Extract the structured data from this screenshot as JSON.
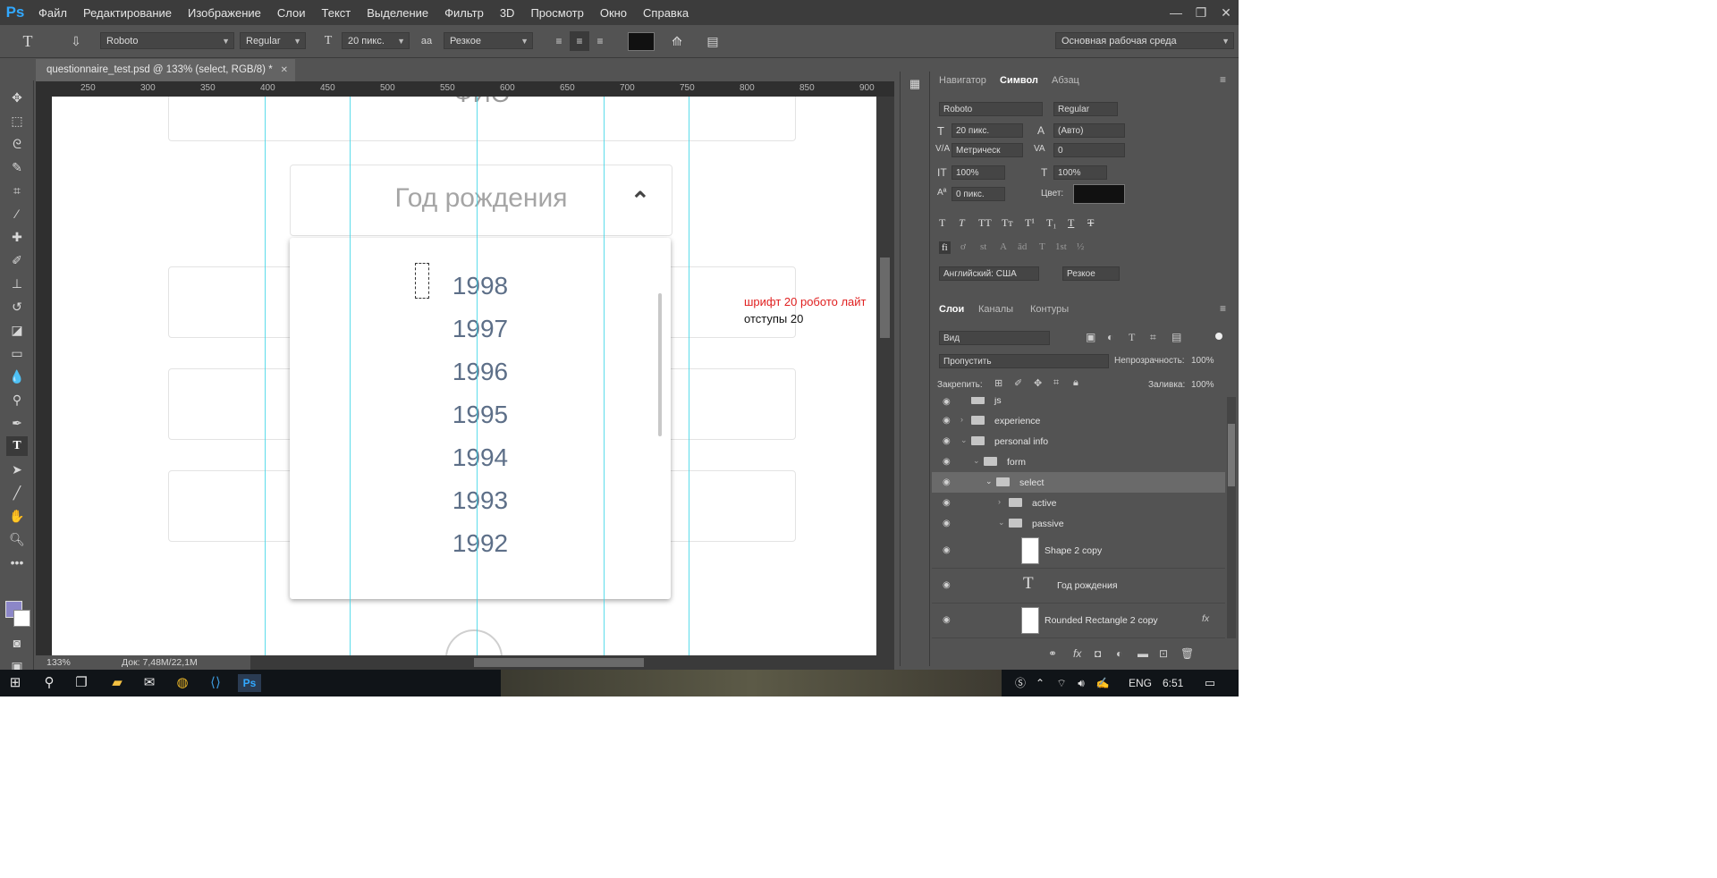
{
  "app": {
    "logo": "Ps",
    "menu": [
      "Файл",
      "Редактирование",
      "Изображение",
      "Слои",
      "Текст",
      "Выделение",
      "Фильтр",
      "3D",
      "Просмотр",
      "Окно",
      "Справка"
    ],
    "window_controls": [
      "—",
      "❐",
      "✕"
    ]
  },
  "options_bar": {
    "tool_icon": "T",
    "font_family": "Roboto",
    "font_style": "Regular",
    "font_size": "20 пикс.",
    "aa_label": "аа",
    "anti_alias": "Резкое",
    "workspace": "Основная рабочая среда"
  },
  "document": {
    "tab_title": "questionnaire_test.psd @ 133% (select, RGB/8) *",
    "tab_close": "✕",
    "zoom": "133%",
    "doc_info": "Док: 7,48M/22,1M",
    "ruler_ticks": [
      "250",
      "300",
      "350",
      "400",
      "450",
      "500",
      "550",
      "600",
      "650",
      "700",
      "750",
      "800",
      "850",
      "900"
    ],
    "fio_text": "ФИО",
    "select_placeholder": "Год рождения",
    "select_chevron": "⌃",
    "years": [
      "1998",
      "1997",
      "1996",
      "1995",
      "1994",
      "1993",
      "1992"
    ],
    "note_line1": "шрифт 20 робото лайт",
    "note_line2": "отступы 20",
    "note_color": "#e02020"
  },
  "panel_tabs_top": [
    "Навигатор",
    "Символ",
    "Абзац"
  ],
  "character": {
    "font_family": "Roboto",
    "font_style": "Regular",
    "size": "20 пикс.",
    "leading": "(Авто)",
    "kerning": "Метрическ",
    "tracking": "0",
    "vscale": "100%",
    "hscale": "100%",
    "baseline": "0 пикс.",
    "color_label": "Цвет:",
    "language": "Английский: США",
    "aa": "Резкое",
    "style_buttons": [
      "T",
      "T",
      "TT",
      "Tт",
      "T¹",
      "T₁",
      "T",
      "T"
    ],
    "ot_buttons": [
      "fi",
      "ơ",
      "st",
      "A",
      "ād",
      "T",
      "1st",
      "½"
    ]
  },
  "layers_panel": {
    "tabs": [
      "Слои",
      "Каналы",
      "Контуры"
    ],
    "filter": "Вид",
    "blend": "Пропустить",
    "opacity_label": "Непрозрачность:",
    "opacity": "100%",
    "lock_label": "Закрепить:",
    "fill_label": "Заливка:",
    "fill": "100%",
    "layers": [
      {
        "name": "js"
      },
      {
        "name": "experience"
      },
      {
        "name": "personal info"
      },
      {
        "name": "form"
      },
      {
        "name": "select"
      },
      {
        "name": "active"
      },
      {
        "name": "passive"
      },
      {
        "name": "Shape 2 copy"
      },
      {
        "name": "Год рождения"
      },
      {
        "name": "Rounded Rectangle 2 copy"
      }
    ],
    "fx": "fx"
  },
  "taskbar": {
    "lang": "ENG",
    "time": "6:51",
    "app_ps": "Ps"
  }
}
